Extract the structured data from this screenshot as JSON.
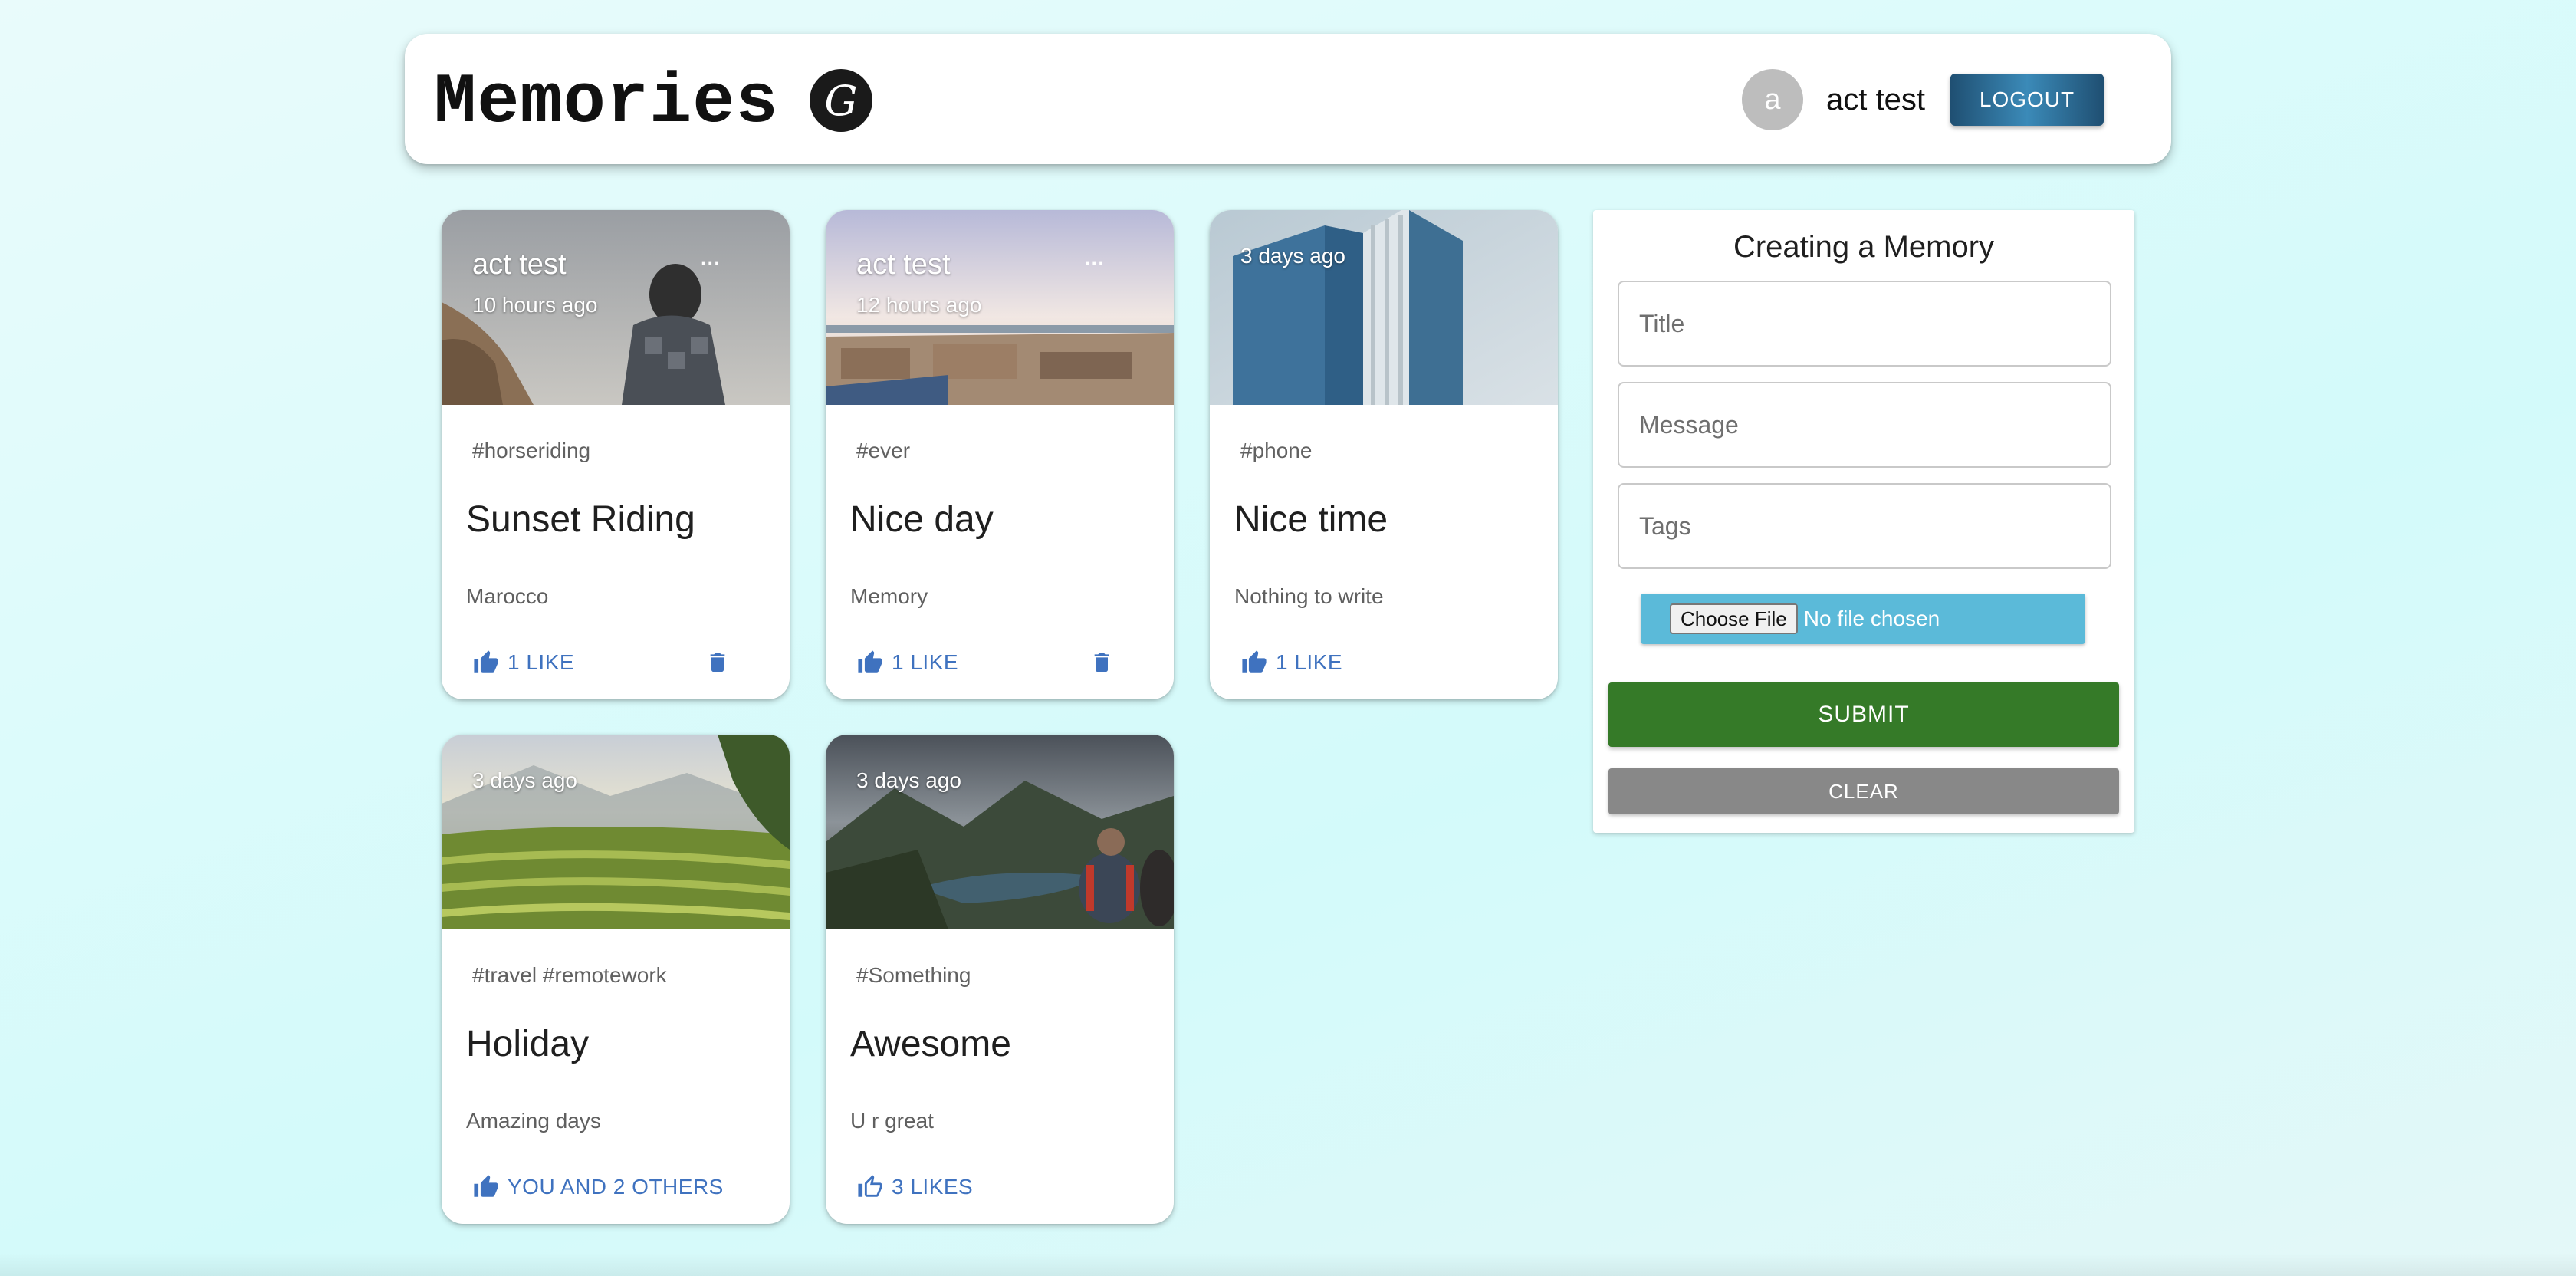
{
  "header": {
    "brand": "Memories",
    "logo_letter": "G",
    "avatar_letter": "a",
    "username": "act test",
    "logout_label": "LOGOUT"
  },
  "posts": [
    {
      "author": "act test",
      "time": "10 hours ago",
      "more": "···",
      "tags": "#horseriding",
      "title": "Sunset Riding",
      "message": "Marocco",
      "likes": "1 LIKE",
      "deletable": true
    },
    {
      "author": "act test",
      "time": "12 hours ago",
      "more": "···",
      "tags": "#ever",
      "title": "Nice day",
      "message": "Memory",
      "likes": "1 LIKE",
      "deletable": true
    },
    {
      "author": "",
      "time": "3 days ago",
      "tags": "#phone",
      "title": "Nice time",
      "message": "Nothing to write",
      "likes": "1 LIKE",
      "deletable": false
    },
    {
      "author": "",
      "time": "3 days ago",
      "tags": "#travel #remotework",
      "title": "Holiday",
      "message": "Amazing days",
      "likes": "YOU AND 2 OTHERS",
      "deletable": false
    },
    {
      "author": "",
      "time": "3 days ago",
      "tags": "#Something",
      "title": "Awesome",
      "message": "U r great",
      "likes": "3 LIKES",
      "deletable": false
    }
  ],
  "form": {
    "title": "Creating a Memory",
    "title_placeholder": "Title",
    "message_placeholder": "Message",
    "tags_placeholder": "Tags",
    "choose_file_label": "Choose File",
    "file_status": "No file chosen",
    "submit_label": "SUBMIT",
    "clear_label": "CLEAR"
  },
  "icons": {
    "like": "thumb-up-icon",
    "delete": "trash-icon"
  },
  "colors": {
    "like": "#3f72bf",
    "submit": "#357a28",
    "clear": "#888888",
    "file_box": "#5bbad9",
    "logout": "#2c6a94"
  }
}
